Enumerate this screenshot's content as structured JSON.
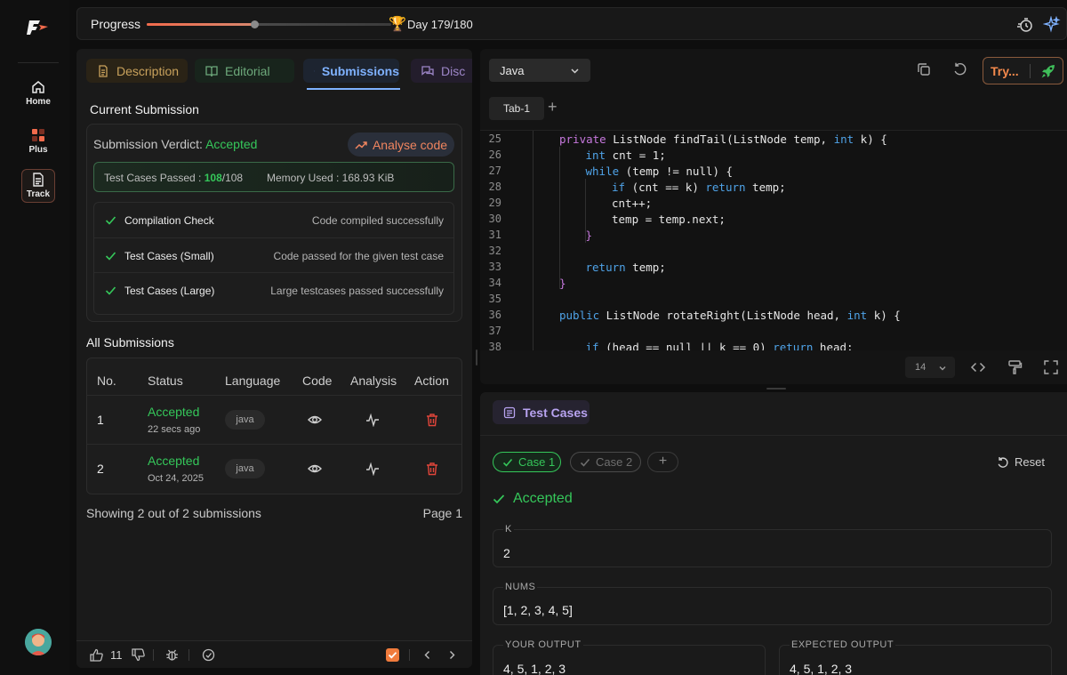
{
  "rail": {
    "items": [
      {
        "label": "Home"
      },
      {
        "label": "Plus"
      },
      {
        "label": "Track"
      }
    ]
  },
  "topbar": {
    "progress_label": "Progress",
    "progress_fraction": 0.44,
    "day_label": "Day 179/180"
  },
  "tabs": {
    "description": "Description",
    "editorial": "Editorial",
    "submissions": "Submissions",
    "discuss": "Disc"
  },
  "current": {
    "title": "Current Submission",
    "verdict_prefix": "Submission Verdict: ",
    "verdict": "Accepted",
    "analyse_label": "Analyse code",
    "tests_label": "Test Cases Passed : ",
    "tests_passed": "108",
    "tests_total": "/108",
    "memory": "Memory Used : 168.93 KiB",
    "checks": [
      {
        "name": "Compilation Check",
        "msg": "Code compiled successfully"
      },
      {
        "name": "Test Cases (Small)",
        "msg": "Code passed for the given test case"
      },
      {
        "name": "Test Cases (Large)",
        "msg": "Large testcases passed successfully"
      }
    ]
  },
  "all": {
    "title": "All Submissions",
    "headers": [
      "No.",
      "Status",
      "Language",
      "Code",
      "Analysis",
      "Action"
    ],
    "rows": [
      {
        "no": "1",
        "status": "Accepted",
        "time": "22 secs ago",
        "lang": "java"
      },
      {
        "no": "2",
        "status": "Accepted",
        "time": "Oct 24, 2025",
        "lang": "java"
      }
    ],
    "showing": "Showing 2 out of 2 submissions",
    "page": "Page 1"
  },
  "footer": {
    "likes": "11"
  },
  "editor": {
    "language": "Java",
    "try_label": "Try...",
    "tab": "Tab-1",
    "font_size": "14",
    "lines": [
      {
        "n": "25",
        "indent": 1,
        "tokens": [
          [
            "kw",
            "private "
          ],
          [
            "fn",
            "ListNode findTail("
          ],
          [
            "fn",
            "ListNode temp, "
          ],
          [
            "ty",
            "int"
          ],
          [
            "fn",
            " k) {"
          ]
        ]
      },
      {
        "n": "26",
        "indent": 2,
        "tokens": [
          [
            "ty",
            "int"
          ],
          [
            "fn",
            " cnt = 1;"
          ]
        ]
      },
      {
        "n": "27",
        "indent": 2,
        "tokens": [
          [
            "ty",
            "while"
          ],
          [
            "fn",
            " (temp != null) {"
          ]
        ]
      },
      {
        "n": "28",
        "indent": 3,
        "tokens": [
          [
            "ty",
            "if"
          ],
          [
            "fn",
            " (cnt == k) "
          ],
          [
            "ty",
            "return"
          ],
          [
            "fn",
            " temp;"
          ]
        ]
      },
      {
        "n": "29",
        "indent": 3,
        "tokens": [
          [
            "fn",
            "cnt++;"
          ]
        ]
      },
      {
        "n": "30",
        "indent": 3,
        "tokens": [
          [
            "fn",
            "temp = temp.next;"
          ]
        ]
      },
      {
        "n": "31",
        "indent": 2,
        "tokens": [
          [
            "kw",
            "}"
          ]
        ]
      },
      {
        "n": "32",
        "indent": 0,
        "tokens": []
      },
      {
        "n": "33",
        "indent": 2,
        "tokens": [
          [
            "ty",
            "return"
          ],
          [
            "fn",
            " temp;"
          ]
        ]
      },
      {
        "n": "34",
        "indent": 1,
        "tokens": [
          [
            "kw",
            "}"
          ]
        ]
      },
      {
        "n": "35",
        "indent": 0,
        "tokens": []
      },
      {
        "n": "36",
        "indent": 1,
        "tokens": [
          [
            "ty",
            "public"
          ],
          [
            "fn",
            " ListNode rotateRight(ListNode head, "
          ],
          [
            "ty",
            "int"
          ],
          [
            "fn",
            " k) {"
          ]
        ]
      },
      {
        "n": "37",
        "indent": 0,
        "tokens": []
      },
      {
        "n": "38",
        "indent": 2,
        "tokens": [
          [
            "ty",
            "if"
          ],
          [
            "fn",
            " (head == null || k == 0) "
          ],
          [
            "ty",
            "return"
          ],
          [
            "fn",
            " head;"
          ]
        ]
      }
    ]
  },
  "tests": {
    "tab": "Test Cases",
    "case1": "Case 1",
    "case2": "Case 2",
    "reset": "Reset",
    "result": "Accepted",
    "k_label": "K",
    "k_value": "2",
    "nums_label": "NUMS",
    "nums_value": "[1, 2, 3, 4, 5]",
    "your_output_label": "YOUR OUTPUT",
    "your_output_value": "4, 5, 1, 2, 3",
    "expected_output_label": "EXPECTED OUTPUT",
    "expected_output_value": "4, 5, 1, 2, 3"
  },
  "colors": {
    "accent": "#f26b4c",
    "success": "#35c75a",
    "link": "#7fb2ff"
  }
}
